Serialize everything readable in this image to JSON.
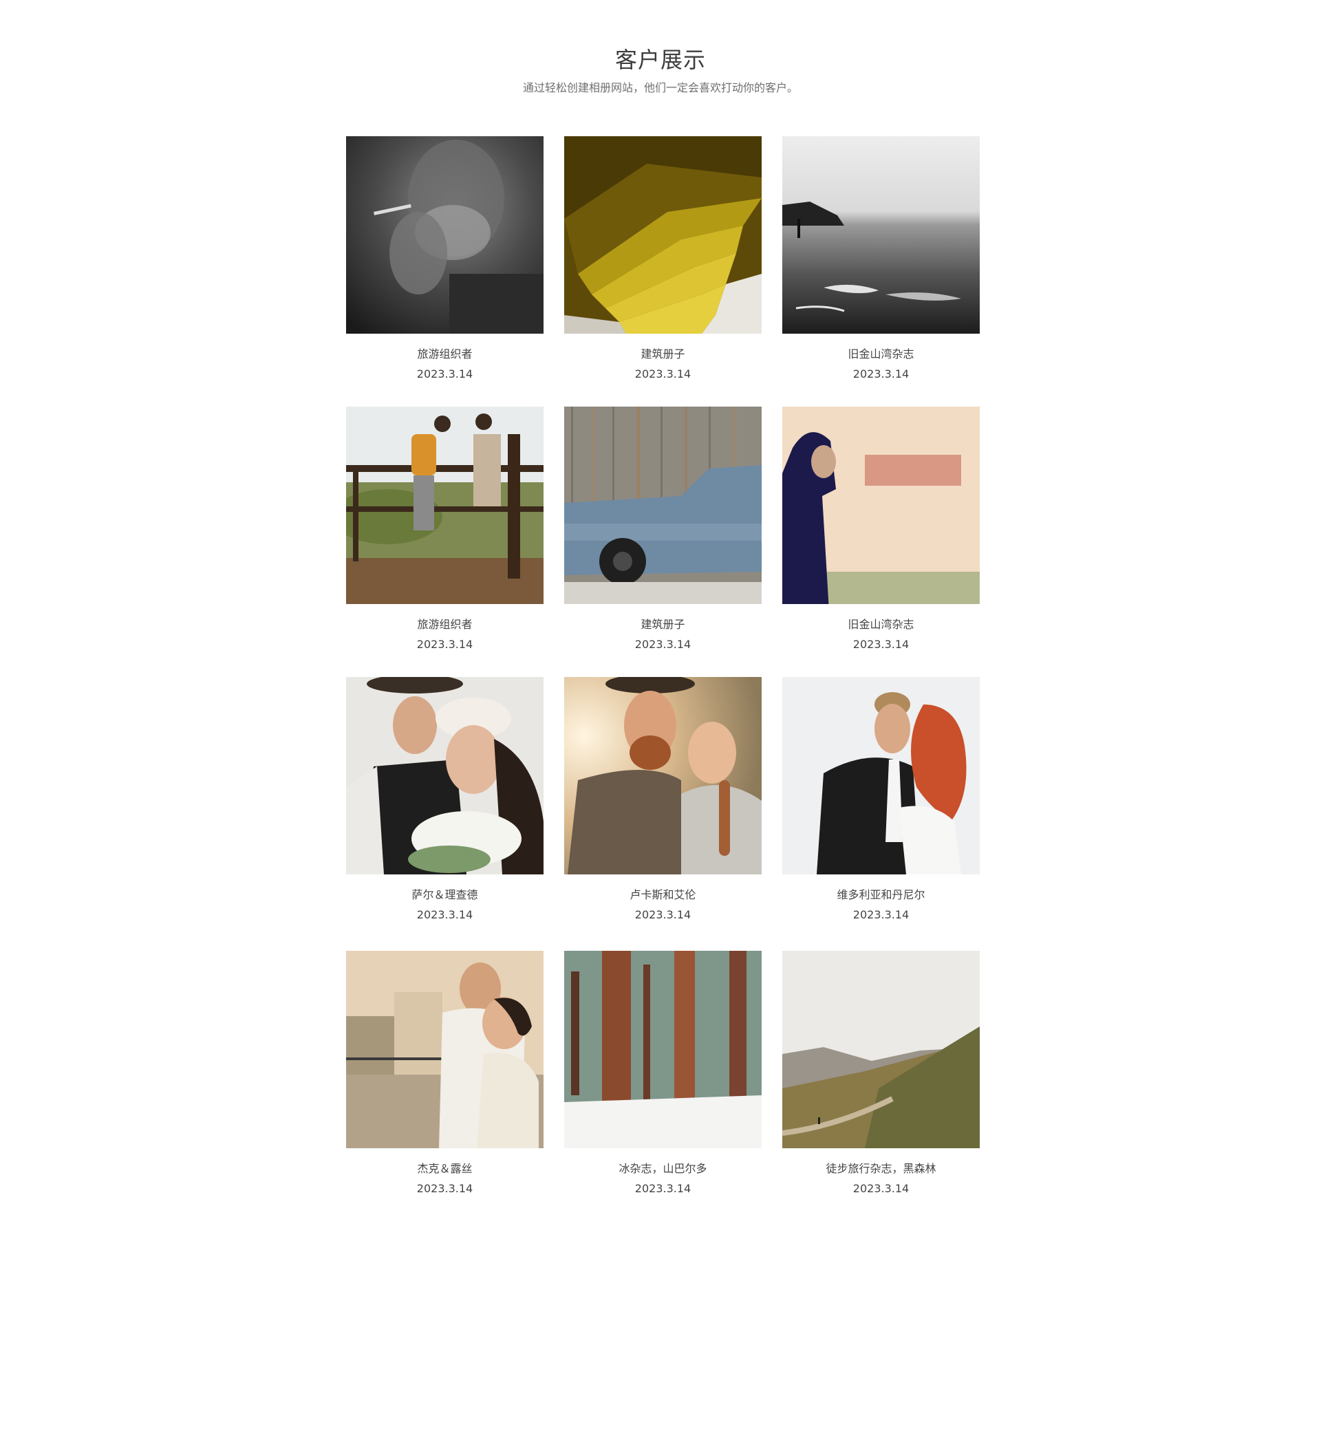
{
  "header": {
    "title": "客户展示",
    "subtitle": "通过轻松创建相册网站，他们一定会喜欢打动你的客户。"
  },
  "gallery": {
    "items": [
      {
        "caption": "旅游组织者",
        "date": "2023.3.14",
        "image": "old-man-smoking-bw-photo"
      },
      {
        "caption": "建筑册子",
        "date": "2023.3.14",
        "image": "yellow-spiral-staircase-photo"
      },
      {
        "caption": "旧金山湾杂志",
        "date": "2023.3.14",
        "image": "bw-beach-surfer-photo"
      },
      {
        "caption": "旅游组织者",
        "date": "2023.3.14",
        "image": "hikers-on-wooden-deck-photo"
      },
      {
        "caption": "建筑册子",
        "date": "2023.3.14",
        "image": "vintage-blue-car-photo"
      },
      {
        "caption": "旧金山湾杂志",
        "date": "2023.3.14",
        "image": "man-in-hoodie-photo"
      },
      {
        "caption": "萨尔＆理查德",
        "date": "2023.3.14",
        "image": "couple-with-flower-crown-photo"
      },
      {
        "caption": "卢卡斯和艾伦",
        "date": "2023.3.14",
        "image": "smiling-couple-photo"
      },
      {
        "caption": "维多利亚和丹尼尔",
        "date": "2023.3.14",
        "image": "wedding-couple-photo"
      },
      {
        "caption": "杰克＆露丝",
        "date": "2023.3.14",
        "image": "couple-hugging-rooftop-photo"
      },
      {
        "caption": "冰杂志，山巴尔多",
        "date": "2023.3.14",
        "image": "redwood-forest-snow-photo"
      },
      {
        "caption": "徒步旅行杂志，黑森林",
        "date": "2023.3.14",
        "image": "mountain-trail-hiker-photo"
      }
    ]
  }
}
